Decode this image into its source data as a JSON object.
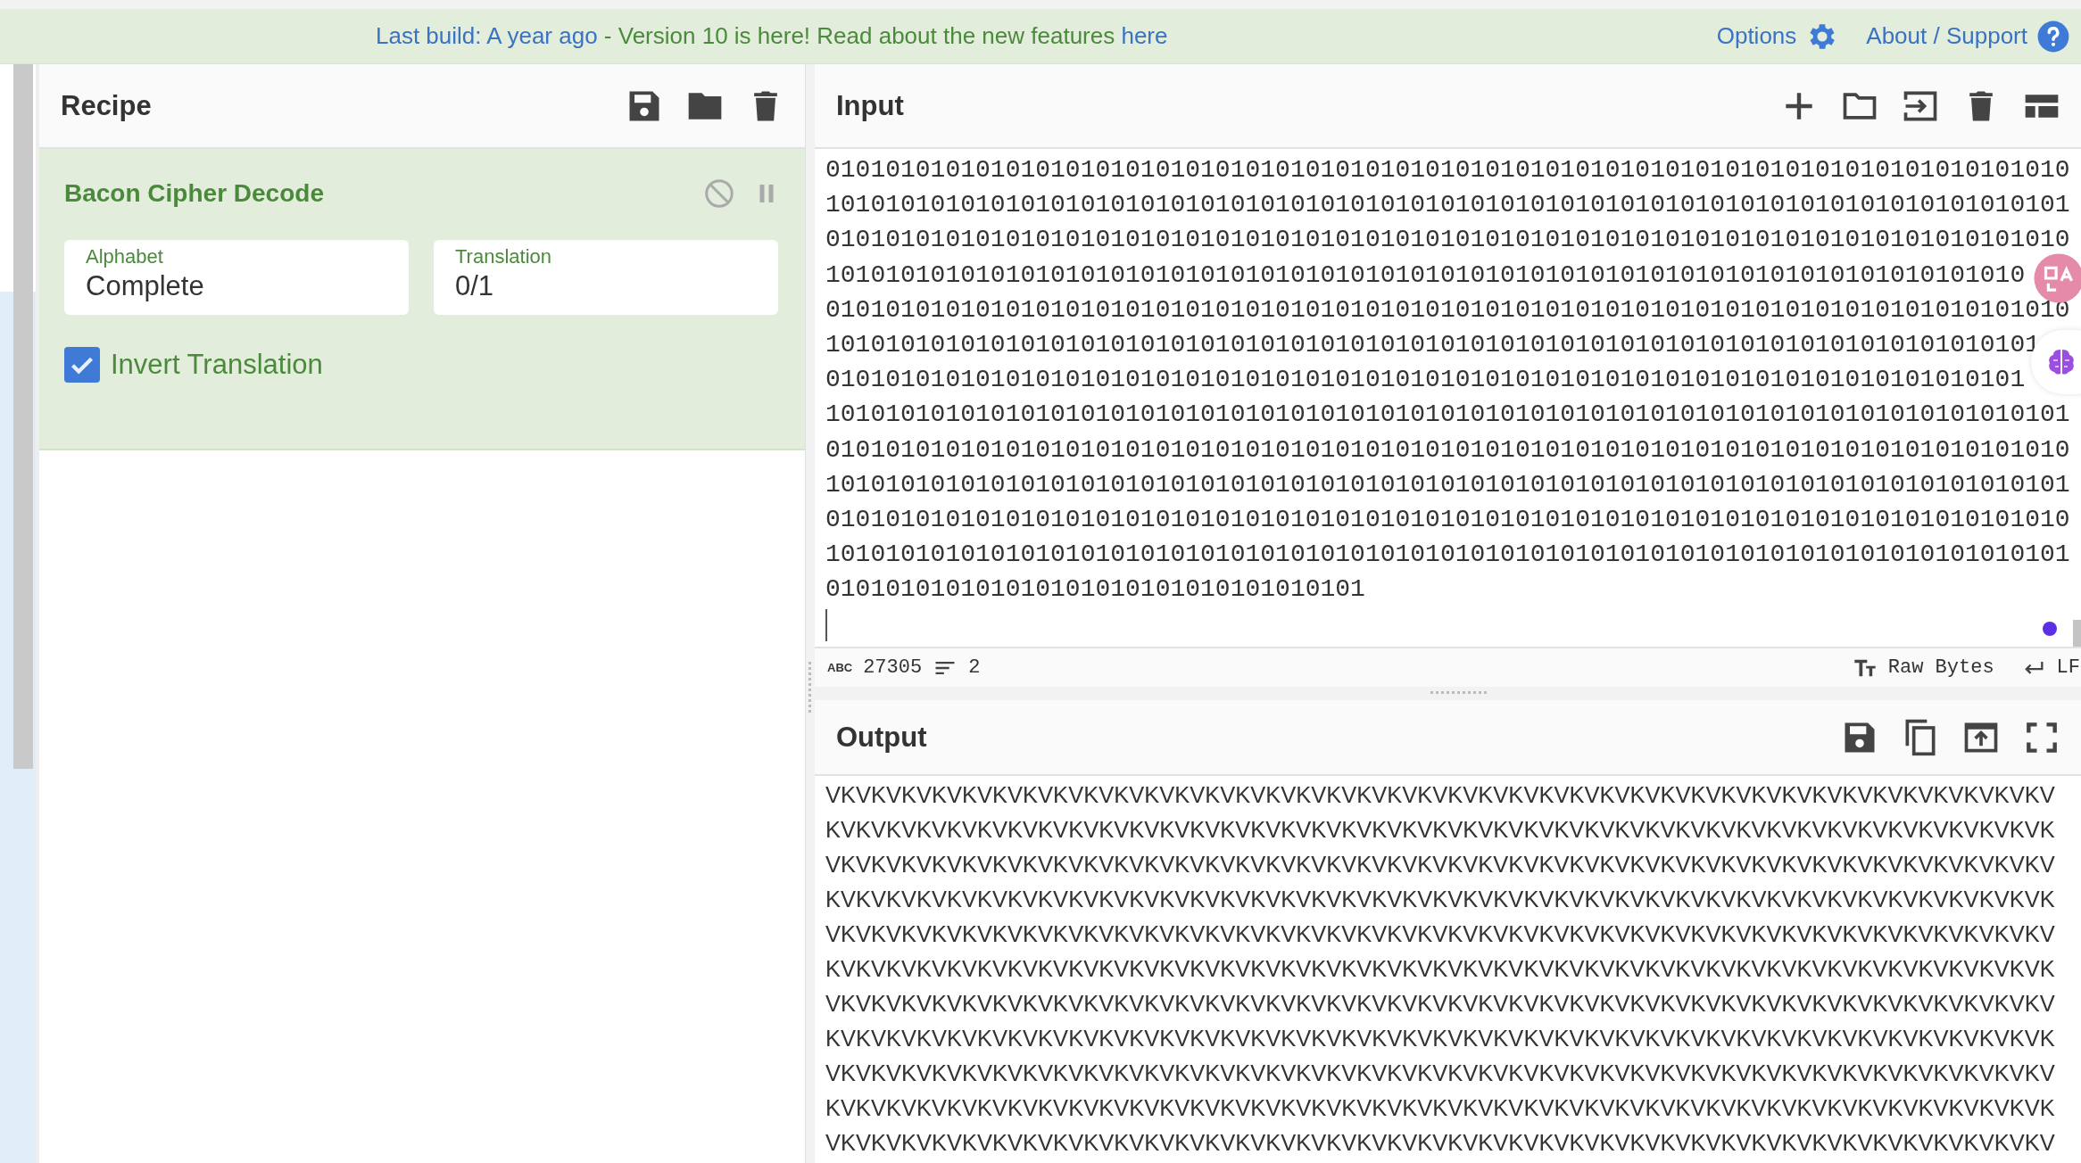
{
  "banner": {
    "build_link": "Last build: A year ago",
    "message": " - Version 10 is here! Read about the new features ",
    "features_link": "here",
    "options": "Options",
    "about": "About / Support"
  },
  "recipe": {
    "title": "Recipe",
    "operations": [
      {
        "name": "Bacon Cipher Decode",
        "disabled": false,
        "breakpoint": false,
        "args": [
          {
            "kind": "dropdown",
            "label": "Alphabet",
            "value": "Complete"
          },
          {
            "kind": "dropdown",
            "label": "Translation",
            "value": "0/1"
          },
          {
            "kind": "checkbox",
            "label": "Invert Translation",
            "checked": true
          }
        ]
      }
    ]
  },
  "input": {
    "title": "Input",
    "lines": [
      "01010101010101010101010101010101010101010101010101010101010101010101010101010101010",
      "10101010101010101010101010101010101010101010101010101010101010101010101010101010101",
      "01010101010101010101010101010101010101010101010101010101010101010101010101010101010",
      "10101010101010101010101010101010101010101010101010101010101010101010101010101010",
      "01010101010101010101010101010101010101010101010101010101010101010101010101010101010",
      "101010101010101010101010101010101010101010101010101010101010101010101010101010101",
      "01010101010101010101010101010101010101010101010101010101010101010101010101010101",
      "10101010101010101010101010101010101010101010101010101010101010101010101010101010101",
      "01010101010101010101010101010101010101010101010101010101010101010101010101010101010",
      "10101010101010101010101010101010101010101010101010101010101010101010101010101010101",
      "01010101010101010101010101010101010101010101010101010101010101010101010101010101010",
      "10101010101010101010101010101010101010101010101010101010101010101010101010101010101",
      "010101010101010101010101010101010101"
    ],
    "status": {
      "length_icon": "ABC",
      "length": "27305",
      "lines": "2",
      "encoding": "Raw Bytes",
      "eol": "LF"
    }
  },
  "output": {
    "title": "Output",
    "lines": [
      "VKVKVKVKVKVKVKVKVKVKVKVKVKVKVKVKVKVKVKVKVKVKVKVKVKVKVKVKVKVKVKVKVKVKVKVKVKVKVKVKV",
      "KVKVKVKVKVKVKVKVKVKVKVKVKVKVKVKVKVKVKVKVKVKVKVKVKVKVKVKVKVKVKVKVKVKVKVKVKVKVKVKVK",
      "VKVKVKVKVKVKVKVKVKVKVKVKVKVKVKVKVKVKVKVKVKVKVKVKVKVKVKVKVKVKVKVKVKVKVKVKVKVKVKVKV",
      "KVKVKVKVKVKVKVKVKVKVKVKVKVKVKVKVKVKVKVKVKVKVKVKVKVKVKVKVKVKVKVKVKVKVKVKVKVKVKVKVK",
      "VKVKVKVKVKVKVKVKVKVKVKVKVKVKVKVKVKVKVKVKVKVKVKVKVKVKVKVKVKVKVKVKVKVKVKVKVKVKVKVKV",
      "KVKVKVKVKVKVKVKVKVKVKVKVKVKVKVKVKVKVKVKVKVKVKVKVKVKVKVKVKVKVKVKVKVKVKVKVKVKVKVKVK",
      "VKVKVKVKVKVKVKVKVKVKVKVKVKVKVKVKVKVKVKVKVKVKVKVKVKVKVKVKVKVKVKVKVKVKVKVKVKVKVKVKV",
      "KVKVKVKVKVKVKVKVKVKVKVKVKVKVKVKVKVKVKVKVKVKVKVKVKVKVKVKVKVKVKVKVKVKVKVKVKVKVKVKVK",
      "VKVKVKVKVKVKVKVKVKVKVKVKVKVKVKVKVKVKVKVKVKVKVKVKVKVKVKVKVKVKVKVKVKVKVKVKVKVKVKVKV",
      "KVKVKVKVKVKVKVKVKVKVKVKVKVKVKVKVKVKVKVKVKVKVKVKVKVKVKVKVKVKVKVKVKVKVKVKVKVKVKVKVK",
      "VKVKVKVKVKVKVKVKVKVKVKVKVKVKVKVKVKVKVKVKVKVKVKVKVKVKVKVKVKVKVKVKVKVKVKVKVKVKVKVKV"
    ]
  }
}
